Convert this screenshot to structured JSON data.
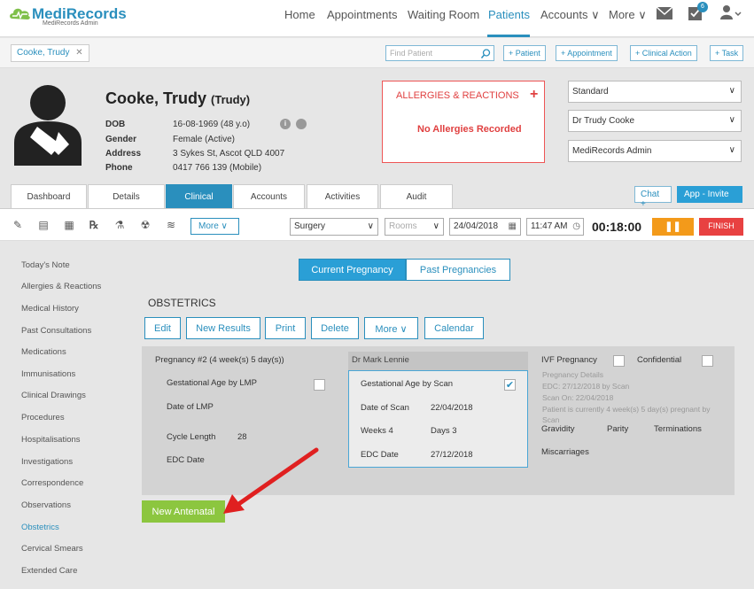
{
  "app": {
    "logo_main": "MediRecords",
    "logo_sub": "MediRecords Admin"
  },
  "nav": {
    "items": [
      "Home",
      "Appointments",
      "Waiting Room",
      "Patients",
      "Accounts ∨",
      "More ∨"
    ],
    "active": "Patients",
    "task_badge": "6"
  },
  "patient_bar": {
    "chip": "Cooke, Trudy",
    "find_placeholder": "Find Patient",
    "buttons": [
      "+ Patient",
      "+ Appointment",
      "+ Clinical Action",
      "+ Task"
    ]
  },
  "patient": {
    "name": "Cooke, Trudy",
    "preferred": "(Trudy)",
    "labels": [
      "DOB",
      "Gender",
      "Address",
      "Phone"
    ],
    "dob": "16-08-1969 (48 y.o)",
    "gender": "Female (Active)",
    "address": "3 Sykes St, Ascot QLD 4007",
    "phone": "0417 766 139 (Mobile)"
  },
  "allergies": {
    "title": "ALLERGIES & REACTIONS",
    "plus": "+",
    "none": "No Allergies Recorded"
  },
  "selects": [
    "Standard",
    "Dr Trudy Cooke",
    "MediRecords Admin"
  ],
  "tabs": [
    "Dashboard",
    "Details",
    "Clinical",
    "Accounts",
    "Activities",
    "Audit"
  ],
  "active_tab": "Clinical",
  "chat_btn": "Chat +",
  "app_invite": "App - Invite",
  "toolbar": {
    "more": "More ∨",
    "location": "Surgery",
    "rooms": "Rooms",
    "date": "24/04/2018",
    "time": "11:47 AM",
    "timer": "00:18:00",
    "pause": "❚❚",
    "finish": "FINISH"
  },
  "sidebar": [
    "Today's Note",
    "Allergies & Reactions",
    "Medical History",
    "Past Consultations",
    "Medications",
    "Immunisations",
    "Clinical Drawings",
    "Procedures",
    "Hospitalisations",
    "Investigations",
    "Correspondence",
    "Observations",
    "Obstetrics",
    "Cervical Smears",
    "Extended Care"
  ],
  "sidebar_active": "Obstetrics",
  "pregnancy_tabs": {
    "current": "Current Pregnancy",
    "past": "Past Pregnancies"
  },
  "obstetrics": {
    "title": "OBSTETRICS",
    "actions": [
      "Edit",
      "New Results",
      "Print",
      "Delete",
      "More ∨",
      "Calendar"
    ],
    "pregnancy": "Pregnancy #2 (4 week(s) 5 day(s))",
    "ga_lmp": "Gestational Age by LMP",
    "date_lmp": "Date of LMP",
    "cycle_length_label": "Cycle Length",
    "cycle_length": "28",
    "edc_date_label": "EDC Date",
    "doctor": "Dr Mark Lennie",
    "scan": {
      "ga_scan": "Gestational Age by Scan",
      "date_scan_label": "Date of Scan",
      "date_scan": "22/04/2018",
      "weeks": "Weeks 4",
      "days": "Days 3",
      "edc_label": "EDC Date",
      "edc": "27/12/2018"
    },
    "ivf": "IVF Pregnancy",
    "confidential": "Confidential",
    "details_lines": [
      "Pregnancy Details",
      "EDC: 27/12/2018 by Scan",
      "Scan On: 22/04/2018",
      "Patient is currently 4 week(s) 5 day(s) pregnant by",
      "Scan"
    ],
    "gravidity": "Gravidity",
    "parity": "Parity",
    "terminations": "Terminations",
    "miscarriages": "Miscarriages",
    "new_antenatal": "New Antenatal"
  },
  "colors": {
    "accent": "#2a8fbd",
    "allergy": "#e04040",
    "pause": "#f39a1a",
    "finish": "#e84141",
    "new_antenatal": "#8cc63f",
    "arrow": "#e02020"
  }
}
